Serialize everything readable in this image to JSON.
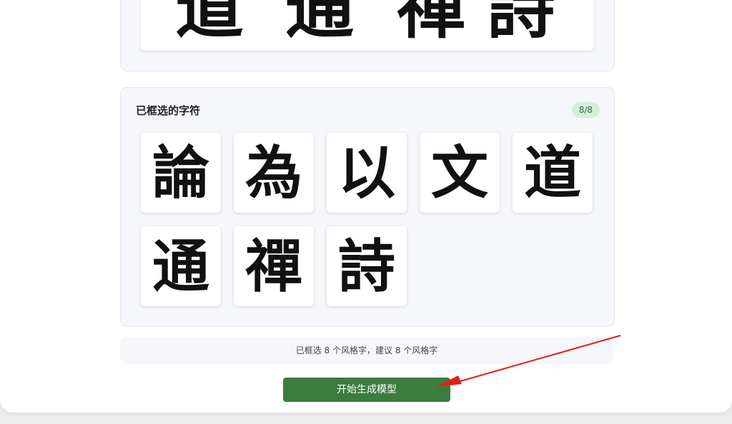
{
  "preview_strip": {
    "chars": [
      "道",
      "通",
      "禪",
      "詩"
    ]
  },
  "selected": {
    "title": "已框选的字符",
    "count_badge": "8/8",
    "chars": [
      "論",
      "為",
      "以",
      "文",
      "道",
      "通",
      "禪",
      "詩"
    ]
  },
  "hint": {
    "text": "已框选 8 个风格字，建议 8 个风格字"
  },
  "actions": {
    "generate_label": "开始生成模型"
  },
  "colors": {
    "primary_button": "#3a7d3e",
    "badge_bg": "#d3efd8",
    "annotation_arrow": "#e0201a"
  }
}
